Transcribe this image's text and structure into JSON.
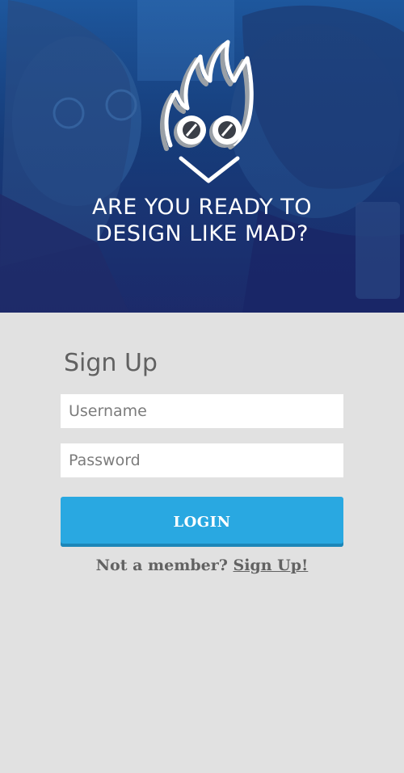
{
  "hero": {
    "headline_line1": "ARE YOU READY TO",
    "headline_line2": "DESIGN LIKE MAD?",
    "logo_icon": "flame-goggles-mascot-icon"
  },
  "form": {
    "title": "Sign Up",
    "username_placeholder": "Username",
    "password_placeholder": "Password",
    "login_label": "LOGIN",
    "member_prompt": "Not a member?",
    "signup_link": "Sign Up!"
  },
  "colors": {
    "button": "#29a8e1",
    "background": "#e1e1e1",
    "text": "#616161"
  }
}
